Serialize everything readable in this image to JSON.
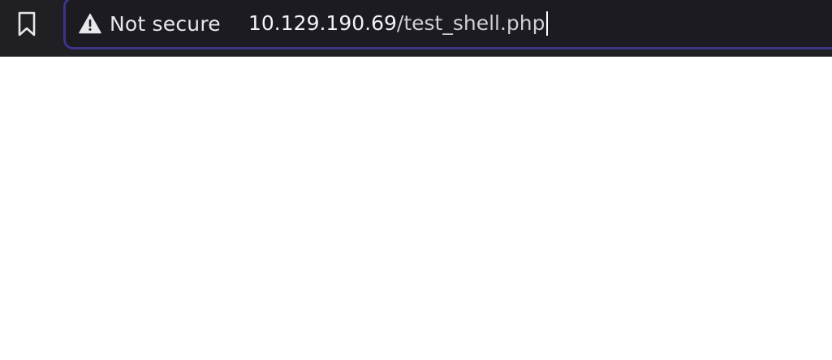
{
  "toolbar": {
    "bookmark": {
      "icon": "bookmark-icon"
    },
    "security": {
      "icon": "warning-triangle-icon",
      "label": "Not secure"
    },
    "url": {
      "host": "10.129.190.69",
      "path": "/test_shell.php"
    }
  },
  "colors": {
    "toolbar_bg": "#202024",
    "urlbar_focus_ring": "#3b3587",
    "text": "#f2f2f4",
    "page_bg": "#ffffff"
  }
}
